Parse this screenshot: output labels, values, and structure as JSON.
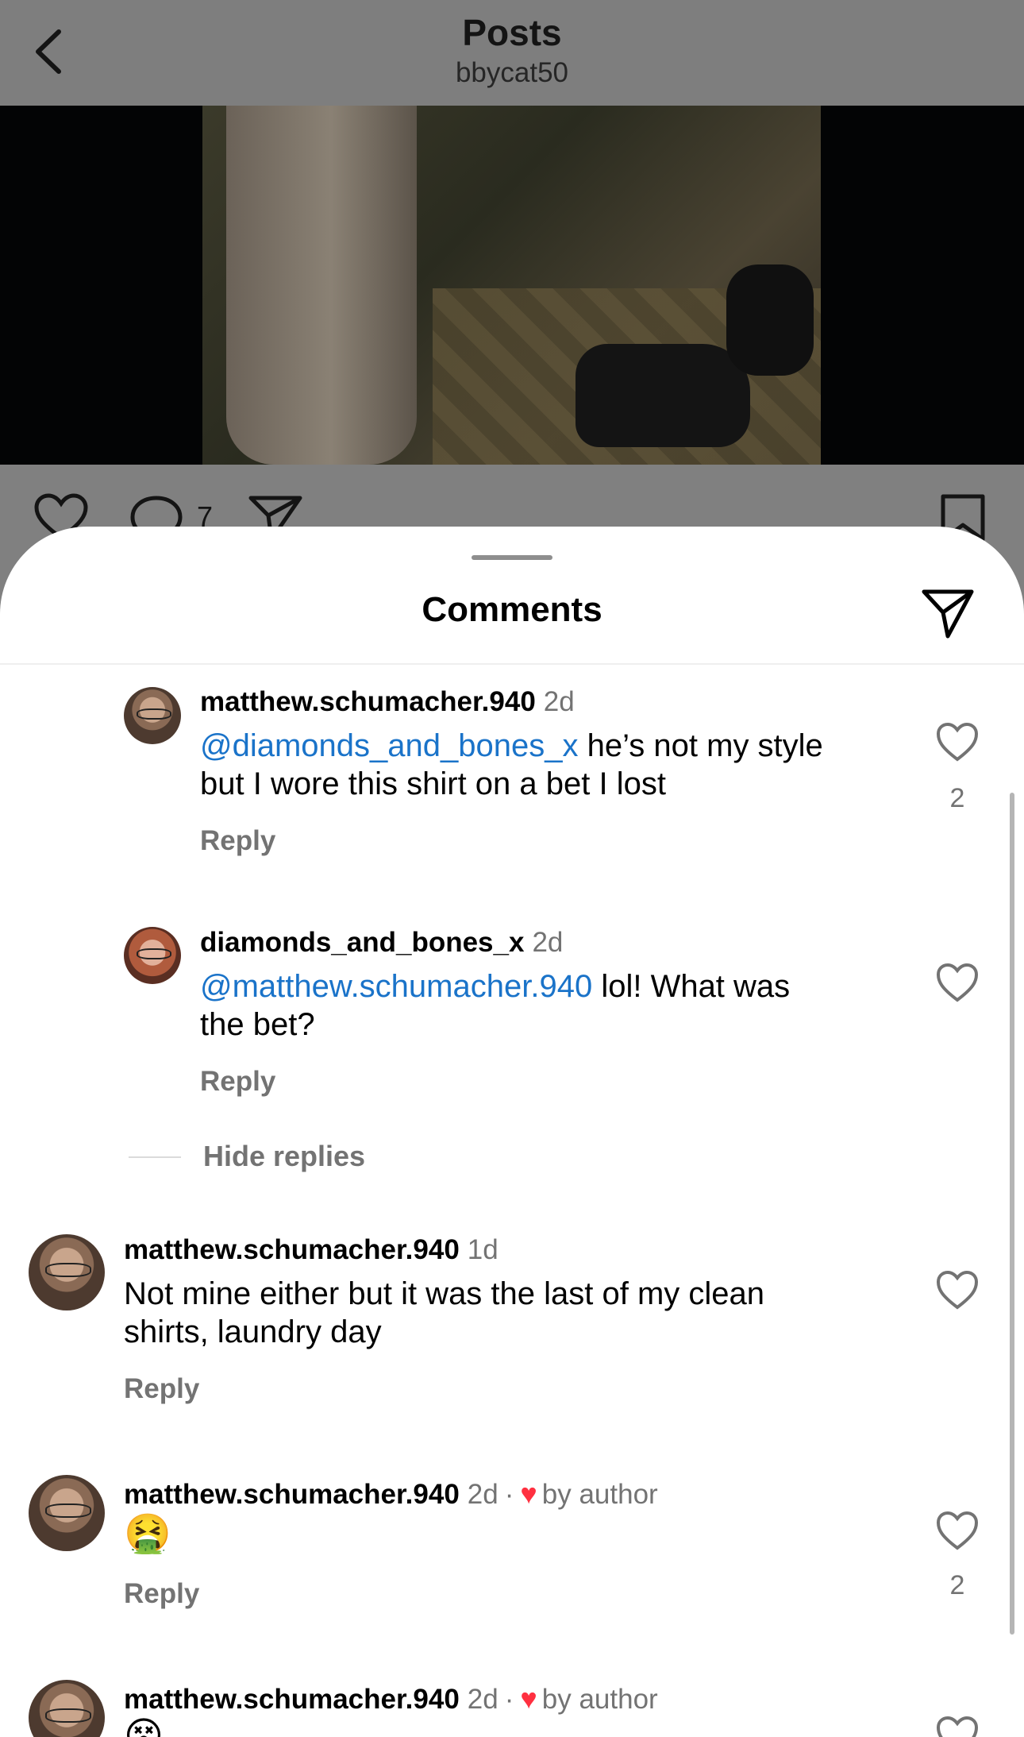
{
  "header": {
    "title": "Posts",
    "subtitle": "bbycat50"
  },
  "post": {
    "comment_count": "7"
  },
  "sheet": {
    "title": "Comments"
  },
  "comments": [
    {
      "username": "matthew.schumacher.940",
      "time": "2d",
      "mention": "@diamonds_and_bones_x",
      "text_line1": " he’s not my style",
      "text_line2": "but I wore this shirt on a bet I lost",
      "reply": "Reply",
      "likes": "2"
    },
    {
      "username": "diamonds_and_bones_x",
      "time": "2d",
      "mention": "@matthew.schumacher.940",
      "text_line1": " lol! What was",
      "text_line2": "the bet?",
      "reply": "Reply"
    },
    {
      "username": "matthew.schumacher.940",
      "time": "1d",
      "text_line1": "Not mine either but it was the last of my clean",
      "text_line2": "shirts, laundry day",
      "reply": "Reply"
    },
    {
      "username": "matthew.schumacher.940",
      "time": "2d",
      "dot": "·",
      "liked_by": "by author",
      "emoji": "🤮",
      "reply": "Reply",
      "likes": "2"
    },
    {
      "username": "matthew.schumacher.940",
      "time": "2d",
      "dot": "·",
      "liked_by": "by author",
      "emoji": "😵"
    }
  ],
  "thread": {
    "hide_replies": "Hide replies"
  },
  "icons": {
    "back": "chevron-left-icon",
    "like": "heart-outline-icon",
    "comment": "speech-bubble-icon",
    "share": "paper-plane-icon",
    "save": "bookmark-icon",
    "author_like": "heart-filled-icon"
  },
  "colors": {
    "mention": "#1a73c9",
    "author_heart": "#ff3040",
    "muted": "#737373"
  }
}
